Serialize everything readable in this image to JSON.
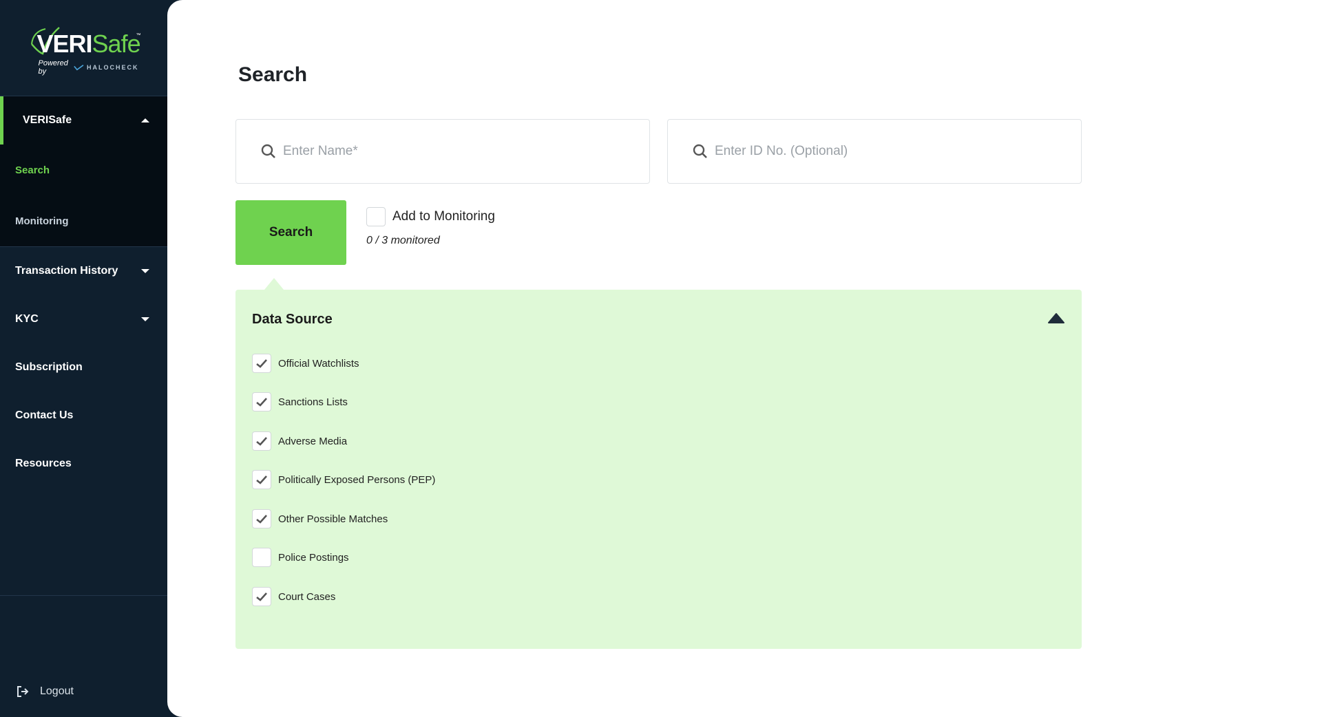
{
  "brand": {
    "logo_name_white": "VERI",
    "logo_name_green": "Safe",
    "tm": "™",
    "powered_by": "Powered by",
    "partner": "HALOCHECK"
  },
  "sidebar": {
    "group": {
      "label": "VERISafe",
      "items": [
        {
          "label": "Search",
          "active": true
        },
        {
          "label": "Monitoring",
          "active": false
        }
      ]
    },
    "items": [
      {
        "label": "Transaction History",
        "has_dropdown": true
      },
      {
        "label": "KYC",
        "has_dropdown": true
      },
      {
        "label": "Subscription",
        "has_dropdown": false
      },
      {
        "label": "Contact Us",
        "has_dropdown": false
      },
      {
        "label": "Resources",
        "has_dropdown": false
      }
    ],
    "logout_label": "Logout"
  },
  "main": {
    "title": "Search",
    "name_input": {
      "placeholder": "Enter Name*",
      "value": ""
    },
    "id_input": {
      "placeholder": "Enter ID No. (Optional)",
      "value": ""
    },
    "search_button": "Search",
    "monitoring": {
      "label": "Add to Monitoring",
      "checked": false,
      "count_text": "0 / 3 monitored"
    },
    "data_source": {
      "title": "Data Source",
      "expanded": true,
      "items": [
        {
          "label": "Official Watchlists",
          "checked": true
        },
        {
          "label": "Sanctions Lists",
          "checked": true
        },
        {
          "label": "Adverse Media",
          "checked": true
        },
        {
          "label": "Politically Exposed Persons (PEP)",
          "checked": true
        },
        {
          "label": "Other Possible Matches",
          "checked": true
        },
        {
          "label": "Police Postings",
          "checked": false
        },
        {
          "label": "Court Cases",
          "checked": true
        }
      ]
    }
  },
  "colors": {
    "sidebar_bg": "#0f1f2e",
    "sidebar_group_bg": "#050d14",
    "accent_green": "#6fd24f",
    "panel_green": "#dff9d7"
  }
}
